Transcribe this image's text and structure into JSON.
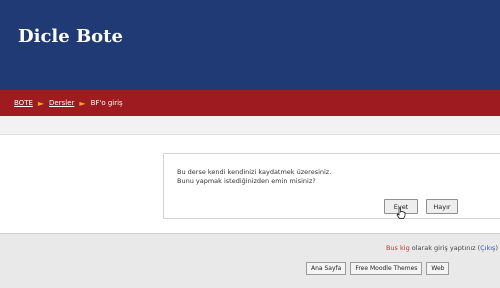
{
  "header": {
    "site_title": "Dicle Bote"
  },
  "breadcrumb": {
    "items": [
      "BOTE",
      "Dersler",
      "BF'o giriş"
    ],
    "separator": "►"
  },
  "notice": {
    "line1": "Bu derse kendi kendinizi kaydatmek üzeresiniz.",
    "line2": "Bunu yapmak istediğinizden emin misiniz?",
    "yes_label": "Evet",
    "no_label": "Hayır"
  },
  "footer": {
    "login_user": "Bus kig",
    "login_text": " olarak giriş yaptınız (",
    "logout_label": "Çıkış",
    "login_close": ")",
    "buttons": [
      "Ana Sayfa",
      "Free Moodle Themes",
      "Web"
    ]
  },
  "colors": {
    "header": "#1f3a74",
    "navbar": "#9e1b1f",
    "separator": "#f5a623"
  }
}
